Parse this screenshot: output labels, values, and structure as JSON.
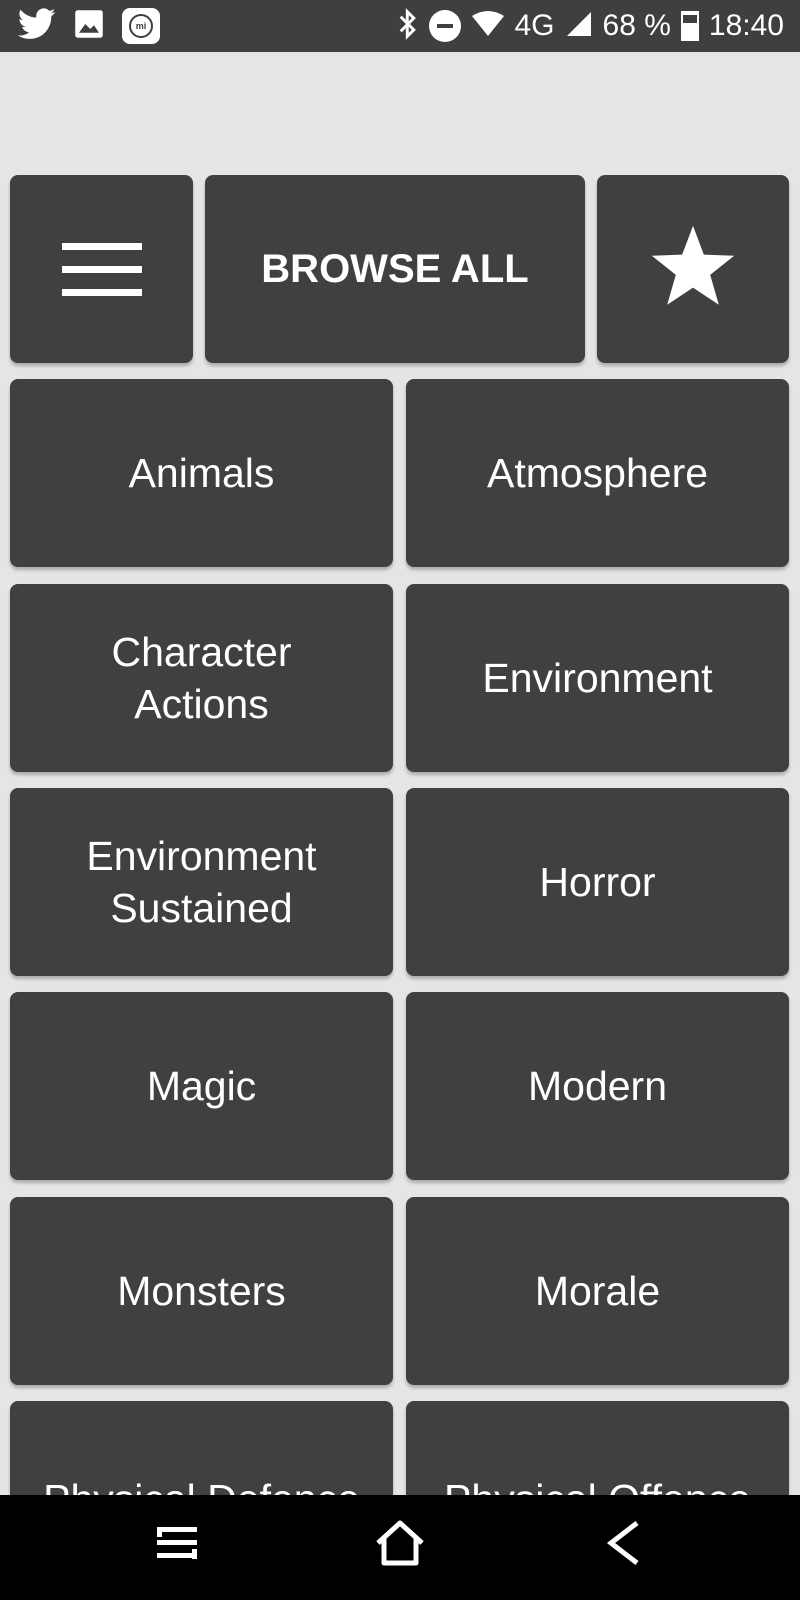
{
  "status_bar": {
    "left_icons": [
      "twitter-icon",
      "image-icon",
      "mi-icon"
    ],
    "mi_text": "mi",
    "network": "4G",
    "battery_percent": "68 %",
    "battery_level": 0.68,
    "time": "18:40"
  },
  "top_row": {
    "menu_icon": "hamburger-icon",
    "browse_label": "BROWSE ALL",
    "favorites_icon": "star-icon"
  },
  "categories": [
    {
      "label": "Animals"
    },
    {
      "label": "Atmosphere"
    },
    {
      "label": "Character\nActions"
    },
    {
      "label": "Environment"
    },
    {
      "label": "Environment\nSustained"
    },
    {
      "label": "Horror"
    },
    {
      "label": "Magic"
    },
    {
      "label": "Modern"
    },
    {
      "label": "Monsters"
    },
    {
      "label": "Morale"
    },
    {
      "label": "Physical Defence"
    },
    {
      "label": "Physical Offence"
    }
  ],
  "nav_bar": {
    "icons": [
      "recents-icon",
      "home-icon",
      "back-icon"
    ]
  }
}
